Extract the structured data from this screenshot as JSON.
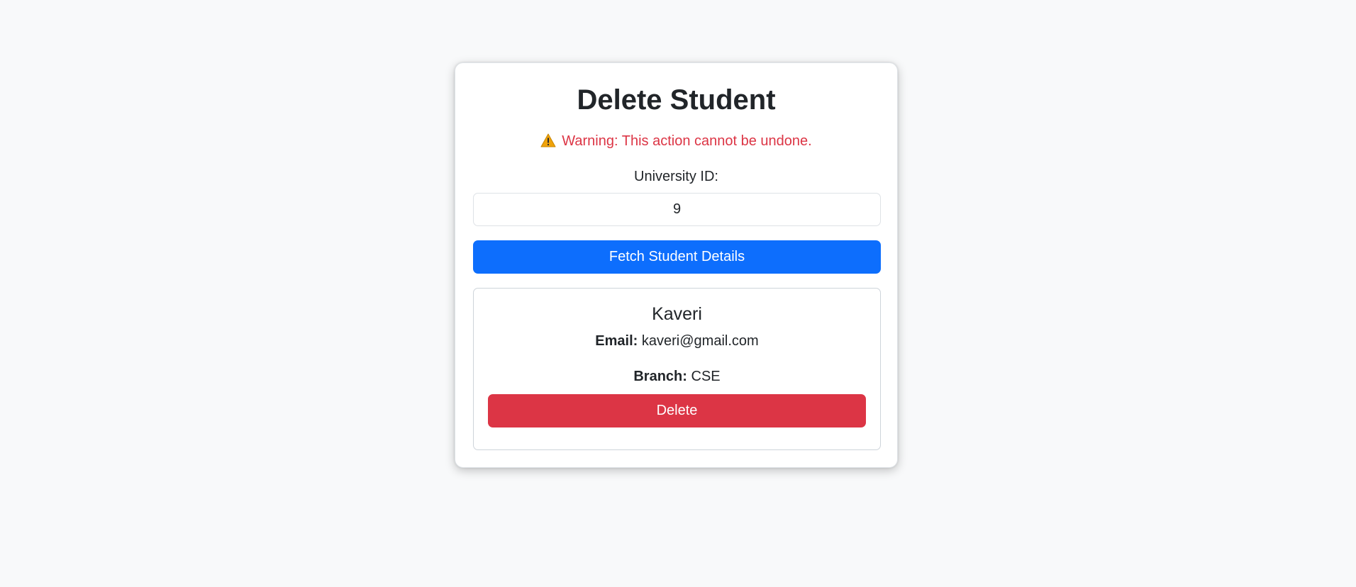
{
  "page": {
    "title": "Delete Student",
    "warning_text": "Warning: This action cannot be undone.",
    "warning_icon": "warning-triangle-icon"
  },
  "form": {
    "id_label": "University ID:",
    "id_value": "9",
    "fetch_button_label": "Fetch Student Details"
  },
  "student": {
    "name": "Kaveri",
    "email_label": "Email:",
    "email": "kaveri@gmail.com",
    "branch_label": "Branch:",
    "branch": "CSE",
    "delete_button_label": "Delete"
  },
  "colors": {
    "primary": "#0d6efd",
    "danger": "#dc3545",
    "warning_icon": "#f0a30a"
  }
}
